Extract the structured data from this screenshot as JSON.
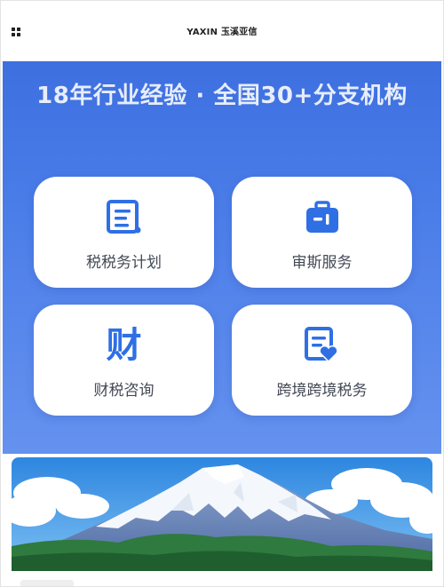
{
  "header": {
    "brand": "YAXIN 玉溪亚信",
    "menu_icon": "grid-icon"
  },
  "hero": {
    "title": "18年行业经验 · 全国30+分支机构"
  },
  "services": [
    {
      "label": "税税务计划",
      "icon": "document-icon"
    },
    {
      "label": "审斯服务",
      "icon": "briefcase-icon"
    },
    {
      "label": "财税咨询",
      "icon": "finance-char-icon",
      "icon_text": "财"
    },
    {
      "label": "跨境跨境税务",
      "icon": "document-heart-icon"
    }
  ],
  "banner": {
    "image": "mountain-landscape-image"
  },
  "colors": {
    "accent": "#2f6fe4",
    "hero_top": "#3d6fe0",
    "hero_bottom": "#6592ef",
    "label": "#444a55"
  }
}
